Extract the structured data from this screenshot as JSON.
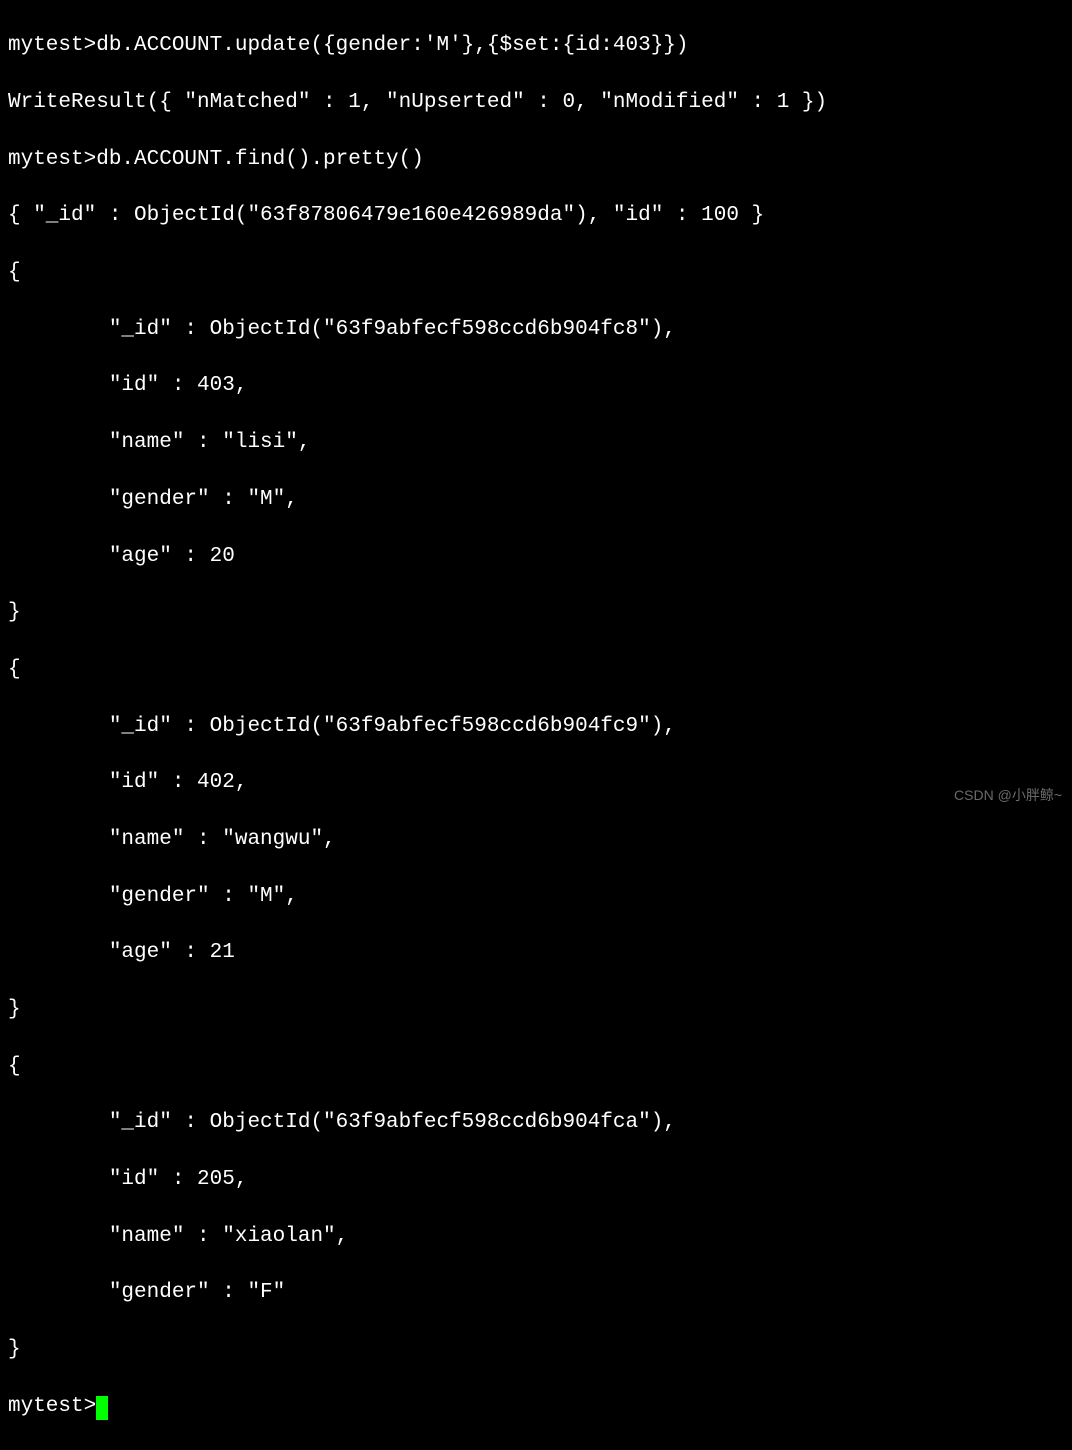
{
  "terminal": {
    "prompt": "mytest>",
    "lines": {
      "l01": "mytest>db.ACCOUNT.update({gender:'M'},{$set:{id:403}})",
      "l02": "WriteResult({ \"nMatched\" : 1, \"nUpserted\" : 0, \"nModified\" : 1 })",
      "l03": "mytest>db.ACCOUNT.find().pretty()",
      "l04": "{ \"_id\" : ObjectId(\"63f87806479e160e426989da\"), \"id\" : 100 }",
      "l05": "{",
      "l06": "        \"_id\" : ObjectId(\"63f9abfecf598ccd6b904fc8\"),",
      "l07": "        \"id\" : 403,",
      "l08": "        \"name\" : \"lisi\",",
      "l09": "        \"gender\" : \"M\",",
      "l10": "        \"age\" : 20",
      "l11": "}",
      "l12": "{",
      "l13": "        \"_id\" : ObjectId(\"63f9abfecf598ccd6b904fc9\"),",
      "l14": "        \"id\" : 402,",
      "l15": "        \"name\" : \"wangwu\",",
      "l16": "        \"gender\" : \"M\",",
      "l17": "        \"age\" : 21",
      "l18": "}",
      "l19": "{",
      "l20": "        \"_id\" : ObjectId(\"63f9abfecf598ccd6b904fca\"),",
      "l21": "        \"id\" : 205,",
      "l22": "        \"name\" : \"xiaolan\",",
      "l23": "        \"gender\" : \"F\"",
      "l24": "}",
      "l25": "mytest>"
    }
  },
  "watermark": "CSDN @小胖鲸~"
}
